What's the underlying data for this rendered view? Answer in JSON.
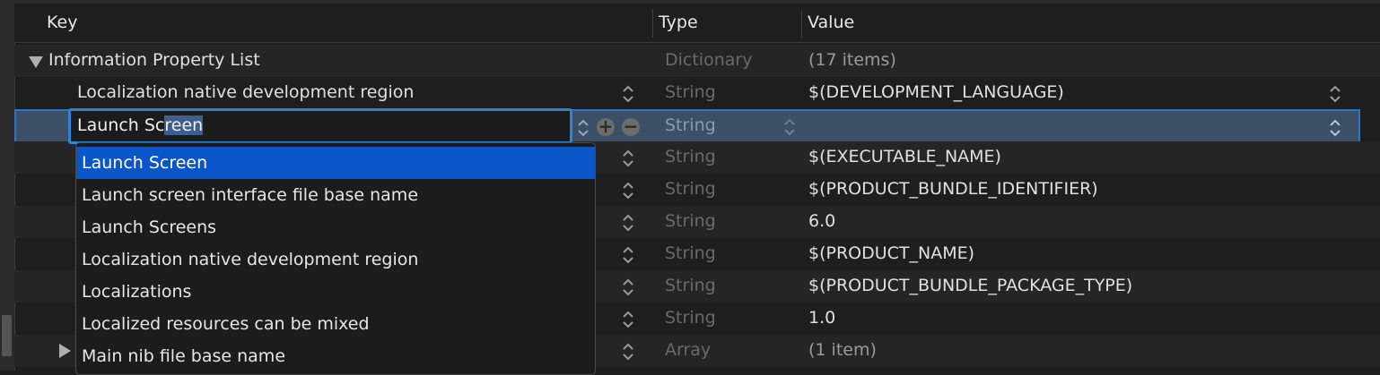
{
  "header": {
    "key_label": "Key",
    "type_label": "Type",
    "value_label": "Value"
  },
  "root": {
    "key": "Information Property List",
    "type": "Dictionary",
    "value": "(17 items)"
  },
  "rows": [
    {
      "key": "Localization native development region",
      "type": "String",
      "value": "$(DEVELOPMENT_LANGUAGE)"
    },
    {
      "key": "",
      "type": "String",
      "value": ""
    },
    {
      "key": "",
      "type": "String",
      "value": "$(EXECUTABLE_NAME)"
    },
    {
      "key": "",
      "type": "String",
      "value": "$(PRODUCT_BUNDLE_IDENTIFIER)"
    },
    {
      "key": "",
      "type": "String",
      "value": "6.0"
    },
    {
      "key": "",
      "type": "String",
      "value": "$(PRODUCT_NAME)"
    },
    {
      "key": "",
      "type": "String",
      "value": "$(PRODUCT_BUNDLE_PACKAGE_TYPE)"
    },
    {
      "key": "",
      "type": "String",
      "value": "1.0"
    },
    {
      "key": "",
      "type": "Array",
      "value": "(1 item)"
    }
  ],
  "editor": {
    "typed": "Launch Sc",
    "completion": "reen"
  },
  "autocomplete": {
    "items": [
      "Launch Screen",
      "Launch screen interface file base name",
      "Launch Screens",
      "Localization native development region",
      "Localizations",
      "Localized resources can be mixed",
      "Main nib file base name"
    ],
    "selected_index": 0
  },
  "colors": {
    "accent": "#2f82d6",
    "selection": "#0a56c9",
    "background": "#1e1e1e"
  },
  "icons": [
    "disclosure-triangle-icon",
    "stepper-icon",
    "add-icon",
    "remove-icon"
  ]
}
